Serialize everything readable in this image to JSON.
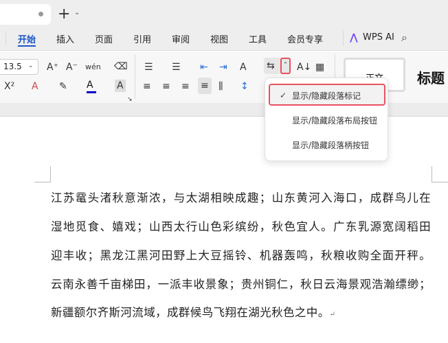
{
  "tabbar": {
    "new_tab": "+",
    "new_tab_caret": "⌄"
  },
  "menu": {
    "items": [
      "开始",
      "插入",
      "页面",
      "引用",
      "审阅",
      "视图",
      "工具",
      "会员专享"
    ],
    "ai_label": "WPS AI",
    "search_icon": "search-icon"
  },
  "ribbon": {
    "font_size": "13.5",
    "increase_font": "A⁺",
    "decrease_font": "A⁻",
    "pinyin": "wén",
    "superscript": "X²",
    "char_shading": "A",
    "style_normal": "正文",
    "style_title": "标题"
  },
  "dropdown": {
    "items": [
      "显示/隐藏段落标记",
      "显示/隐藏段落布局按钮",
      "显示/隐藏段落柄按钮"
    ],
    "checked_index": 0,
    "check": "✓"
  },
  "document": {
    "lines": [
      "江苏鼋头渚秋意渐浓，与太湖相映成趣；山东黄河入海口，成群鸟儿在",
      "湿地觅食、嬉戏；山西太行山色彩缤纷，秋色宜人。广东乳源宽阔稻田",
      "迎丰收；黑龙江黑河田野上大豆摇铃、机器轰鸣，秋粮收购全面开秤。",
      "云南永善千亩梯田，一派丰收景象；贵州铜仁，秋日云海景观浩瀚缥缈；",
      "新疆额尔齐斯河流域，成群候鸟飞翔在湖光秋色之中。"
    ],
    "para_mark": "↵"
  },
  "colors": {
    "accent": "#1a56c8",
    "highlight": "#e9505e",
    "font_color": "#0000cc"
  }
}
